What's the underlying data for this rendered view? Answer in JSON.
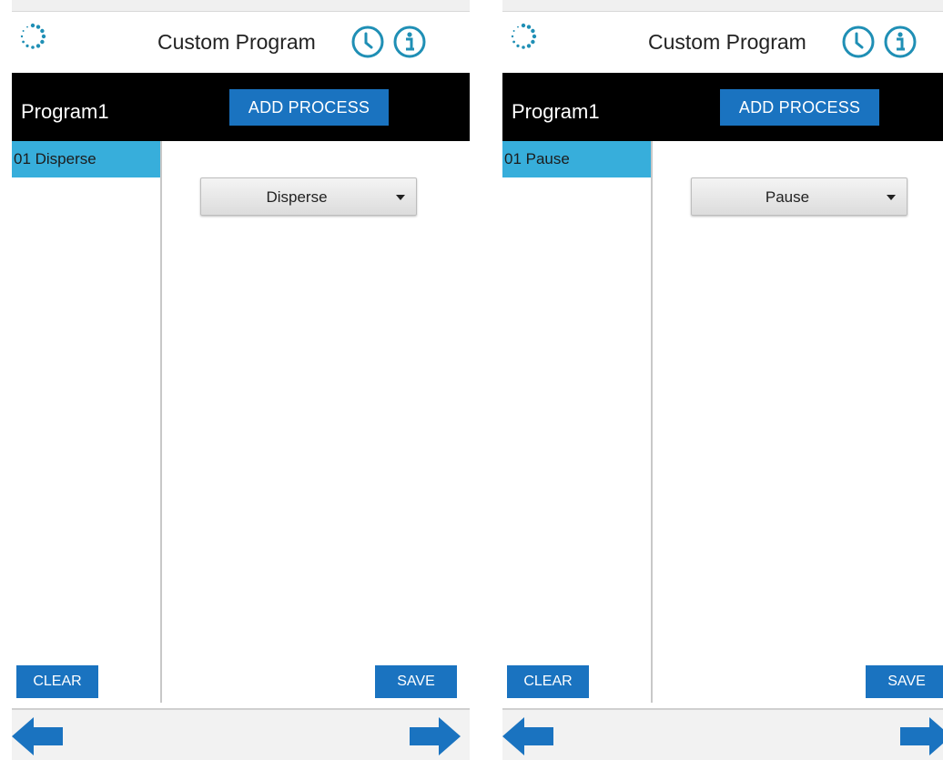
{
  "screens": [
    {
      "app_title": "Custom Program",
      "program_name": "Program1",
      "add_process_label": "ADD PROCESS",
      "process_list": [
        {
          "label": "01 Disperse"
        }
      ],
      "process_select": {
        "value": "Disperse"
      },
      "clear_label": "CLEAR",
      "save_label": "SAVE"
    },
    {
      "app_title": "Custom Program",
      "program_name": "Program1",
      "add_process_label": "ADD PROCESS",
      "process_list": [
        {
          "label": "01 Pause"
        }
      ],
      "process_select": {
        "value": "Pause"
      },
      "clear_label": "CLEAR",
      "save_label": "SAVE"
    }
  ],
  "icons": {
    "logo": "dotted-ring-logo-icon",
    "history": "clock-icon",
    "info": "info-icon",
    "back": "arrow-left-icon",
    "forward": "arrow-right-icon"
  },
  "colors": {
    "accent_blue": "#1a73c0",
    "selected_item": "#37aedb",
    "icon_teal": "#1f8fb5",
    "program_bar": "#000000"
  }
}
